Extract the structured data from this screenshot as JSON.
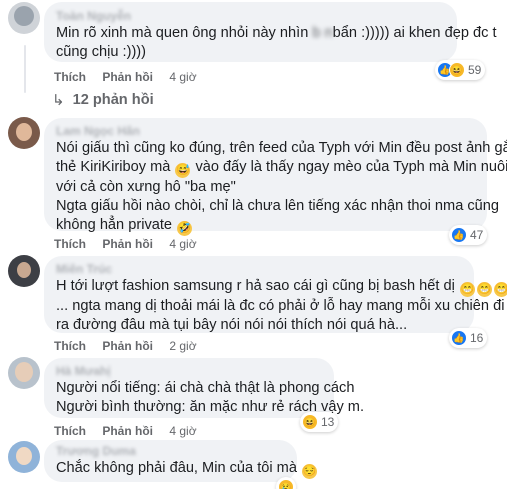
{
  "comments": [
    {
      "author": "Toàn Nguyễn",
      "lines": [
        [
          "Min rõ xinh mà quen ông nhỏi này nhìn ",
          "bẩn :))))) ai khen đẹp đc t"
        ],
        [
          "cũng chịu :))))"
        ]
      ],
      "blurred_word": "b  n",
      "actions": {
        "like": "Thích",
        "reply": "Phản hồi",
        "time": "4 giờ"
      },
      "reaction_count": "59",
      "replies_label": "12 phản hồi"
    },
    {
      "author": "Lam Ngọc Hân",
      "lines": [
        "Nói giấu thì cũng ko đúng, trên feed của Typh với Min đều post ảnh gắn",
        "thẻ KiriKiriboy mà",
        " vào đấy là thấy ngay mèo của Typh mà Min nuôi",
        "với cả còn xưng hô \"ba mẹ\"",
        "Ngta giấu hồi nào chòi, chỉ là chưa lên tiếng xác nhận thoi nma cũng",
        "không hẳn private"
      ],
      "actions": {
        "like": "Thích",
        "reply": "Phản hồi",
        "time": "4 giờ"
      },
      "reaction_count": "47"
    },
    {
      "author": "Miên Trúc",
      "lines": [
        "H tới lượt fashion samsung r hả sao cái gì cũng bị bash hết dị",
        "... ngta mang dị thoải mái là đc có phải ở lỗ hay mang mỗi xu chiên đi",
        "ra đường đâu mà tụi bây nói nói nói thích nói quá hà..."
      ],
      "actions": {
        "like": "Thích",
        "reply": "Phản hồi",
        "time": "2 giờ"
      },
      "reaction_count": "16"
    },
    {
      "author": "Hà Mưahị",
      "lines": [
        "Người nổi tiếng: ái chà chà thật là phong cách",
        "Người bình thường: ăn mặc như rẻ rách vậy m."
      ],
      "actions": {
        "like": "Thích",
        "reply": "Phản hồi",
        "time": "4 giờ"
      },
      "reaction_count": "13"
    },
    {
      "author": "Trương Duma",
      "lines": [
        "Chắc không phải đâu, Min của tôi mà"
      ],
      "actions": {
        "like": "Thích",
        "reply": "Phản hồi",
        "time": "1 giờ"
      }
    }
  ],
  "icons": {
    "like": "thumbs-up-icon",
    "haha": "laughing-face-icon",
    "emoji_face": "emoji-face-icon",
    "reply_arrow": "reply-arrow-icon"
  },
  "colors": {
    "bubble": "#f0f2f5",
    "meta": "#65676b",
    "like_blue": "#1877f2",
    "haha_yellow": "#f7b928"
  }
}
